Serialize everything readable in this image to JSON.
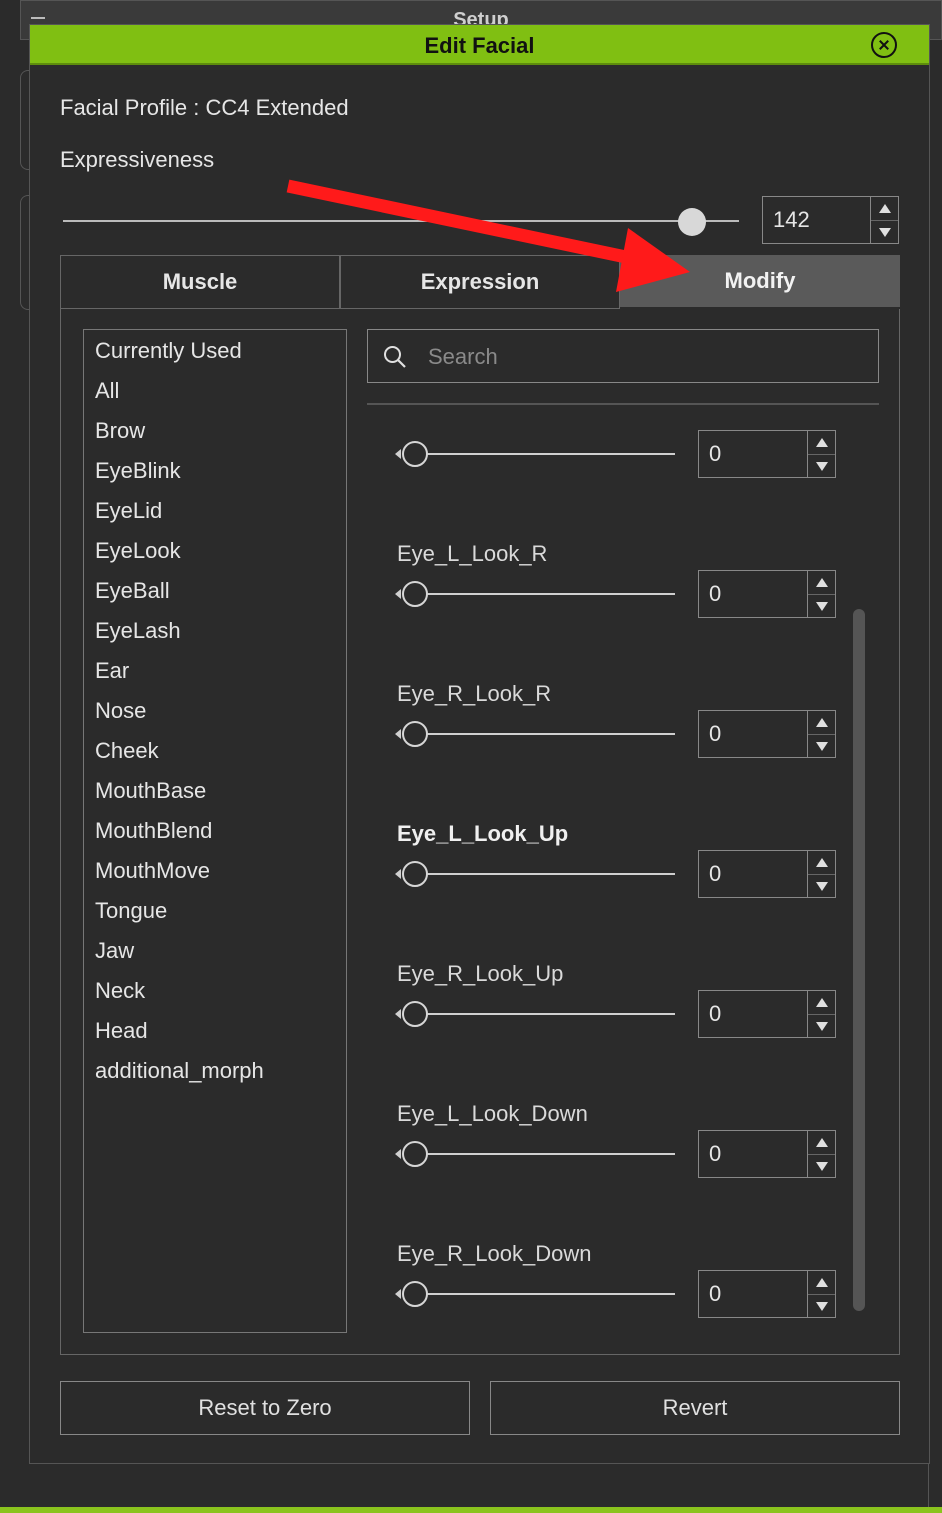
{
  "background_window": {
    "title": "Setup"
  },
  "dialog": {
    "title": "Edit Facial",
    "profile": "Facial Profile : CC4 Extended",
    "expressiveness": {
      "label": "Expressiveness",
      "value": "142",
      "fraction": 0.93
    }
  },
  "tabs": [
    {
      "label": "Muscle",
      "active": false
    },
    {
      "label": "Expression",
      "active": false
    },
    {
      "label": "Modify",
      "active": true
    }
  ],
  "categories": [
    "Currently Used",
    "All",
    "Brow",
    "EyeBlink",
    "EyeLid",
    "EyeLook",
    "EyeBall",
    "EyeLash",
    "Ear",
    "Nose",
    "Cheek",
    "MouthBase",
    "MouthBlend",
    "MouthMove",
    "Tongue",
    "Jaw",
    "Neck",
    "Head",
    "additional_morph"
  ],
  "search": {
    "placeholder": "Search"
  },
  "morphs": [
    {
      "label": "",
      "value": "0",
      "fraction": 0
    },
    {
      "label": "Eye_L_Look_R",
      "value": "0",
      "fraction": 0
    },
    {
      "label": "Eye_R_Look_R",
      "value": "0",
      "fraction": 0
    },
    {
      "label": "Eye_L_Look_Up",
      "value": "0",
      "fraction": 0,
      "highlighted": true
    },
    {
      "label": "Eye_R_Look_Up",
      "value": "0",
      "fraction": 0
    },
    {
      "label": "Eye_L_Look_Down",
      "value": "0",
      "fraction": 0
    },
    {
      "label": "Eye_R_Look_Down",
      "value": "0",
      "fraction": 0
    }
  ],
  "buttons": {
    "reset": "Reset to Zero",
    "revert": "Revert"
  },
  "colors": {
    "title_bar": "#80bf12",
    "annotation_arrow": "#ff1a1a",
    "active_tab": "#5a5a5a"
  }
}
